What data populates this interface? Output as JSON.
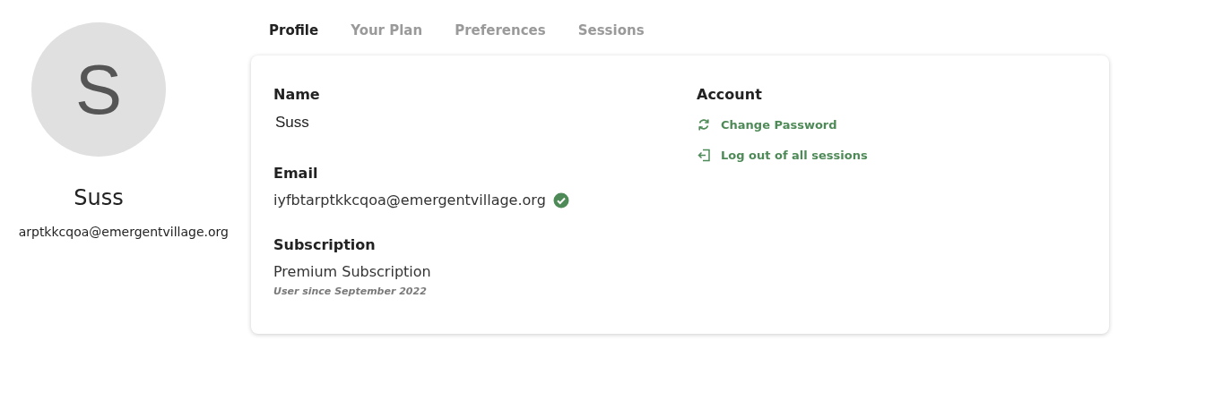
{
  "profile": {
    "initial": "S",
    "name": "Suss",
    "email": "arptkkcqoa@emergentvillage.org"
  },
  "tabs": [
    {
      "label": "Profile",
      "selected": true
    },
    {
      "label": "Your Plan",
      "selected": false
    },
    {
      "label": "Preferences",
      "selected": false
    },
    {
      "label": "Sessions",
      "selected": false
    }
  ],
  "details": {
    "name": {
      "label": "Name",
      "value": "Suss"
    },
    "email": {
      "label": "Email",
      "value": "iyfbtarptkkcqoa@emergentvillage.org",
      "verified": true
    },
    "subscription": {
      "label": "Subscription",
      "value": "Premium Subscription",
      "note": "User since September 2022"
    }
  },
  "account": {
    "title": "Account",
    "actions": [
      {
        "kind": "change-password",
        "label": "Change Password"
      },
      {
        "kind": "logout",
        "label": "Log out of all sessions"
      }
    ]
  }
}
